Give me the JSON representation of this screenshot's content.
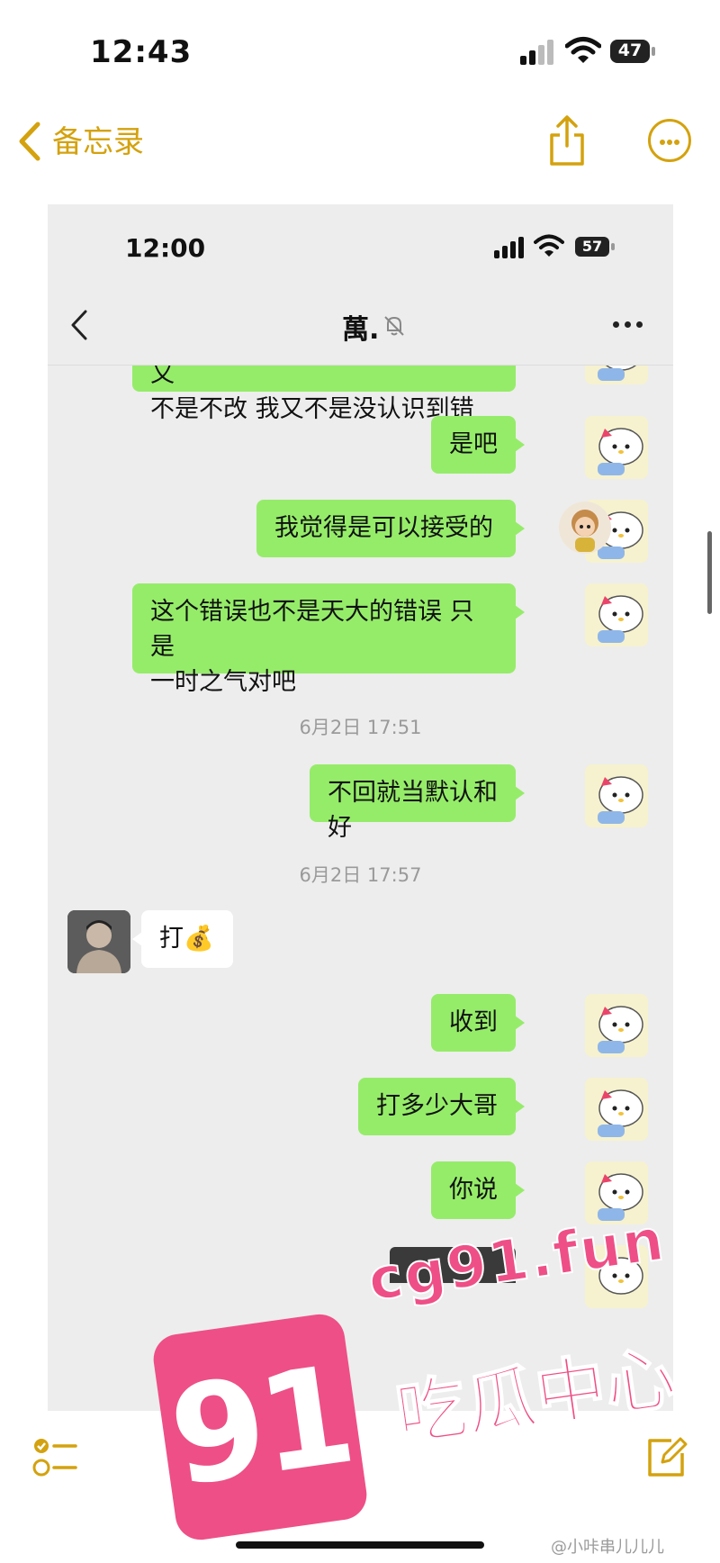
{
  "os_status": {
    "time": "12:43",
    "battery": "47"
  },
  "notes_header": {
    "back_label": "备忘录"
  },
  "screenshot": {
    "status": {
      "time": "12:00",
      "battery": "57"
    },
    "chat": {
      "title": "萬.",
      "messages": [
        {
          "side": "out",
          "text": "就这么一点点点点小事 我以后又\n不是不改 我又不是没认识到错"
        },
        {
          "side": "out",
          "text": "是吧"
        },
        {
          "side": "out",
          "text": "我觉得是可以接受的"
        },
        {
          "side": "out",
          "text": "这个错误也不是天大的错误 只是\n一时之气对吧"
        },
        {
          "side": "time",
          "text": "6月2日 17:51"
        },
        {
          "side": "out",
          "text": "不回就当默认和好"
        },
        {
          "side": "time",
          "text": "6月2日 17:57"
        },
        {
          "side": "in",
          "text": "打💰"
        },
        {
          "side": "out",
          "text": "收到"
        },
        {
          "side": "out",
          "text": "打多少大哥"
        },
        {
          "side": "out",
          "text": "你说"
        }
      ]
    }
  },
  "watermark": {
    "badge": "91",
    "site": "cg91.fun",
    "slogan": "吃瓜中心",
    "weibo": "@小咔串儿儿儿"
  },
  "colors": {
    "accent": "#d4a20e",
    "bubble_out": "#95ec69",
    "watermark": "#ee4f86"
  }
}
